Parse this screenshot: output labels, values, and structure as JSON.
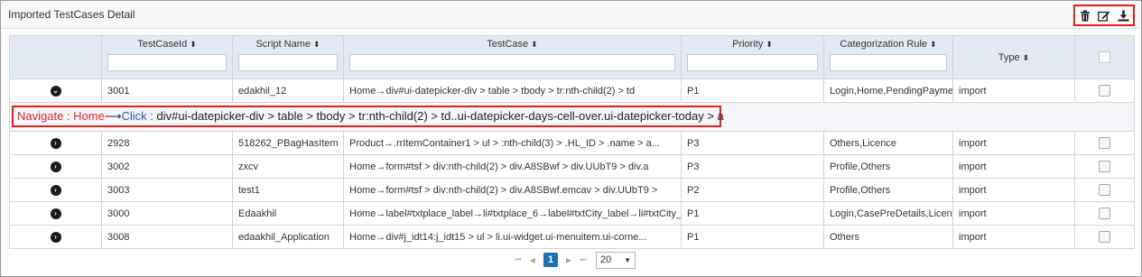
{
  "panel": {
    "title": "Imported TestCases Detail",
    "toolbar": {
      "delete_icon": "trash-icon",
      "edit_icon": "edit-icon",
      "download_icon": "download-icon"
    }
  },
  "table": {
    "columns": [
      {
        "key": "expand",
        "label": ""
      },
      {
        "key": "testcaseid",
        "label": "TestCaseId"
      },
      {
        "key": "script",
        "label": "Script Name"
      },
      {
        "key": "testcase",
        "label": "TestCase"
      },
      {
        "key": "priority",
        "label": "Priority"
      },
      {
        "key": "rule",
        "label": "Categorization Rule"
      },
      {
        "key": "type",
        "label": "Type"
      },
      {
        "key": "select",
        "label": ""
      }
    ],
    "sort_glyph": "⬍",
    "rows": [
      {
        "id": "3001",
        "script": "edakhil_12",
        "testcase": "Home→div#ui-datepicker-div > table > tbody > tr:nth-child(2) > td",
        "priority": "P1",
        "rule": "Login,Home,PendingPaymer",
        "type": "import"
      },
      {
        "id": "2928",
        "script": "518262_PBagHasItem",
        "testcase": "Product→.rrItemContainer1 > ul > :nth-child(3) > .HL_ID > .name > a...",
        "priority": "P3",
        "rule": "Others,Licence",
        "type": "import"
      },
      {
        "id": "3002",
        "script": "zxcv",
        "testcase": "Home→form#tsf > div:nth-child(2) > div.A8SBwf > div.UUbT9 > div.a",
        "priority": "P3",
        "rule": "Profile,Others",
        "type": "import"
      },
      {
        "id": "3003",
        "script": "test1",
        "testcase": "Home→form#tsf > div:nth-child(2) > div.A8SBwf.emcav > div.UUbT9 >",
        "priority": "P2",
        "rule": "Profile,Others",
        "type": "import"
      },
      {
        "id": "3000",
        "script": "Edaakhil",
        "testcase": "Home→label#txtplace_label→li#txtplace_6→label#txtCity_label→li#txtCity_",
        "priority": "P1",
        "rule": "Login,CasePreDetails,Licenc",
        "type": "import"
      },
      {
        "id": "3008",
        "script": "edaakhil_Application",
        "testcase": "Home→div#j_idt14:j_idt15 > ul > li.ui-widget.ui-menuitem.ui-corne...",
        "priority": "P1",
        "rule": "Others",
        "type": "import"
      }
    ],
    "expanded_detail": {
      "navigate_label": "Navigate : ",
      "home": "Home",
      "arrow": "⟶",
      "click_label": "Click : ",
      "selector": "div#ui-datepicker-div > table > tbody > tr:nth-child(2) > td..ui-datepicker-days-cell-over.ui-datepicker-today > a"
    }
  },
  "pager": {
    "first": "⏮",
    "prev": "◀",
    "current_page": "1",
    "next": "▶",
    "last": "⏭",
    "page_size": "20",
    "page_size_arrow": "▼"
  },
  "colors": {
    "accent_red": "#e01f1f",
    "header_bg": "#e3eaf4",
    "page_current": "#1d6fb0",
    "click_blue": "#2b4fc7"
  }
}
